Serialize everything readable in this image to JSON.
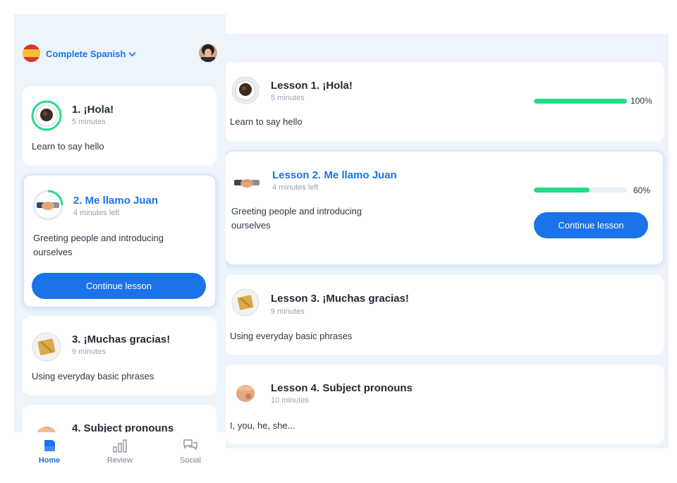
{
  "phone": {
    "course_title": "Complete Spanish",
    "lessons": [
      {
        "title": "1. ¡Hola!",
        "duration": "5 minutes",
        "description": "Learn to say hello",
        "progress": 1.0
      },
      {
        "title": "2. Me llamo Juan",
        "duration": "4 minutes left",
        "description": "Greeting people and introducing ourselves",
        "progress": 0.6,
        "button": "Continue lesson"
      },
      {
        "title": "3. ¡Muchas gracias!",
        "duration": "9 minutes",
        "description": "Using everyday basic phrases"
      },
      {
        "title": "4. Subject pronouns"
      }
    ],
    "tabs": [
      {
        "label": "Home",
        "icon": "home-icon",
        "active": true
      },
      {
        "label": "Review",
        "icon": "bar-chart-icon",
        "active": false
      },
      {
        "label": "Social",
        "icon": "chat-bubbles-icon",
        "active": false
      }
    ]
  },
  "tablet": {
    "lessons": [
      {
        "title": "Lesson 1. ¡Hola!",
        "duration": "5 minutes",
        "description": "Learn to say hello",
        "progress": 1.0,
        "progress_label": "100%"
      },
      {
        "title": "Lesson 2. Me llamo Juan",
        "duration": "4 minutes left",
        "description": "Greeting people and introducing ourselves",
        "progress": 0.6,
        "progress_label": "60%",
        "button": "Continue lesson"
      },
      {
        "title": "Lesson 3. ¡Muchas gracias!",
        "duration": "9 minutes",
        "description": "Using everyday basic phrases"
      },
      {
        "title": "Lesson 4. Subject pronouns",
        "duration": "10 minutes",
        "description": "I, you, he, she..."
      }
    ]
  },
  "colors": {
    "accent": "#1a73e8",
    "progress": "#22dd88",
    "panel_bg": "#eef4fc"
  }
}
